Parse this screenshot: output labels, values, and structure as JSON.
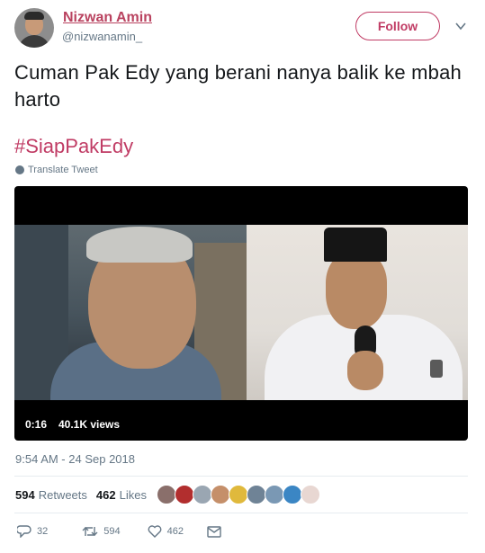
{
  "author": {
    "name": "Nizwan Amin",
    "handle": "@nizwanamin_"
  },
  "follow_label": "Follow",
  "tweet": {
    "text": "Cuman Pak Edy yang berani nanya balik ke mbah harto",
    "hashtag": "#SiapPakEdy",
    "translate_label": "Translate Tweet"
  },
  "video": {
    "duration": "0:16",
    "views": "40.1K views"
  },
  "timestamp": "9:54 AM - 24 Sep 2018",
  "stats": {
    "retweets_count": "594",
    "retweets_label": "Retweets",
    "likes_count": "462",
    "likes_label": "Likes"
  },
  "actions": {
    "reply_count": "32",
    "retweet_count": "594",
    "like_count": "462"
  },
  "colors": {
    "brand": "#c03b64",
    "name": "#b9425f",
    "muted": "#657786"
  },
  "liker_avatar_colors": [
    "#8a6f6b",
    "#b22e2e",
    "#9aa6b2",
    "#c58f6a",
    "#e0b93c",
    "#6f8396",
    "#7a98b4",
    "#3b86c4",
    "#e8d7d2"
  ]
}
